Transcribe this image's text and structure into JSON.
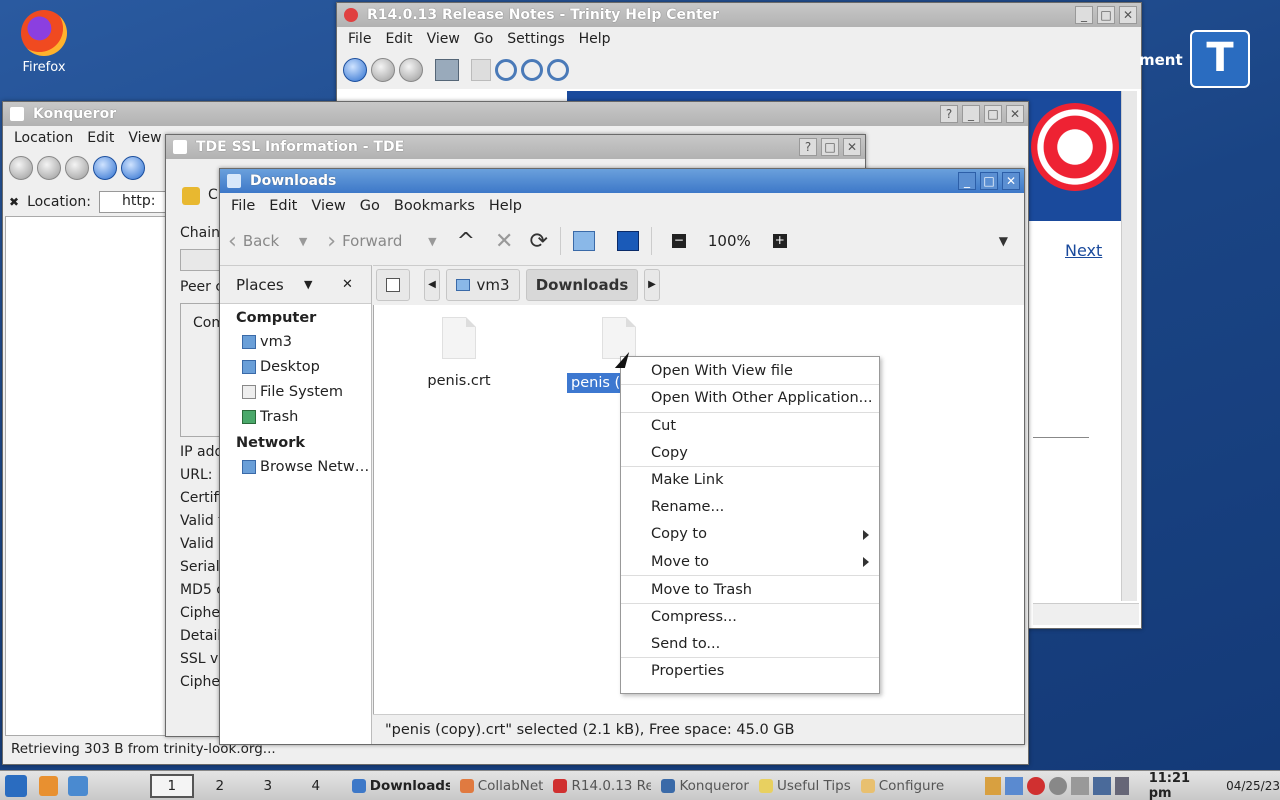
{
  "desktop": {
    "firefox_label": "Firefox"
  },
  "help_window": {
    "title": "R14.0.13 Release Notes - Trinity Help Center",
    "menu": [
      "File",
      "Edit",
      "View",
      "Go",
      "Settings",
      "Help"
    ],
    "partial_text": "ment",
    "next_link": "Next"
  },
  "konqueror": {
    "title": "Konqueror",
    "menu": [
      "Location",
      "Edit",
      "View"
    ],
    "location_label": "Location:",
    "location_value": "http:",
    "status": "Retrieving 303 B from trinity-look.org..."
  },
  "ssl": {
    "title": "TDE SSL Information - TDE",
    "lines": [
      "C",
      "Chain",
      "Peer c",
      "Com",
      "IP add",
      "URL:",
      "Certifi",
      "Valid f",
      "Valid",
      "Serial",
      "MD5 c",
      "Ciphe",
      "Detail",
      "SSL ve",
      "Ciphe"
    ]
  },
  "downloads": {
    "title": "Downloads",
    "menu": [
      "File",
      "Edit",
      "View",
      "Go",
      "Bookmarks",
      "Help"
    ],
    "nav": {
      "back": "Back",
      "forward": "Forward",
      "zoom": "100%"
    },
    "places": {
      "header": "Places",
      "computer_label": "Computer",
      "computer_items": [
        "vm3",
        "Desktop",
        "File System",
        "Trash"
      ],
      "network_label": "Network",
      "network_items": [
        "Browse Netw…"
      ]
    },
    "path": {
      "parent": "vm3",
      "current": "Downloads"
    },
    "files": [
      {
        "name": "penis.crt"
      },
      {
        "name": "penis (c"
      }
    ],
    "status": "\"penis (copy).crt\" selected (2.1 kB), Free space: 45.0 GB"
  },
  "context_menu": {
    "items": [
      {
        "label": "Open With View file",
        "submenu": false,
        "sep": false
      },
      {
        "label": "Open With Other Application...",
        "submenu": false,
        "sep": true
      },
      {
        "label": "Cut",
        "submenu": false,
        "sep": true
      },
      {
        "label": "Copy",
        "submenu": false,
        "sep": false
      },
      {
        "label": "Make Link",
        "submenu": false,
        "sep": true
      },
      {
        "label": "Rename...",
        "submenu": false,
        "sep": false
      },
      {
        "label": "Copy to",
        "submenu": true,
        "sep": false
      },
      {
        "label": "Move to",
        "submenu": true,
        "sep": false
      },
      {
        "label": "Move to Trash",
        "submenu": false,
        "sep": true
      },
      {
        "label": "Compress...",
        "submenu": false,
        "sep": true
      },
      {
        "label": "Send to...",
        "submenu": false,
        "sep": false
      },
      {
        "label": "Properties",
        "submenu": false,
        "sep": true
      }
    ]
  },
  "taskbar": {
    "desktops": [
      "1",
      "2",
      "3",
      "4"
    ],
    "tasks": [
      {
        "label": "Downloads",
        "bold": true,
        "color": "#3d78c8"
      },
      {
        "label": "CollabNet",
        "bold": false,
        "color": "#e07a40"
      },
      {
        "label": "R14.0.13 Re",
        "bold": false,
        "color": "#d03030"
      },
      {
        "label": "Konqueror",
        "bold": false,
        "color": "#3a6aa8"
      },
      {
        "label": "Useful Tips",
        "bold": false,
        "color": "#e8d060"
      },
      {
        "label": "Configure",
        "bold": false,
        "color": "#e8c070"
      }
    ],
    "time": "11:21 pm",
    "date": "04/25/23"
  }
}
